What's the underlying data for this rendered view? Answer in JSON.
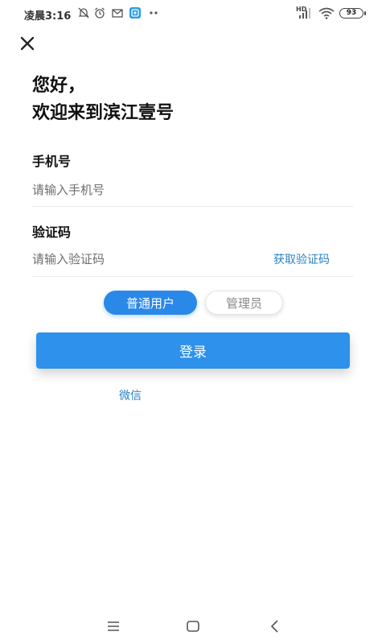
{
  "status_bar": {
    "time": "凌晨3:16",
    "network_label": "HD",
    "battery": "93",
    "icons": [
      "bell-muted-icon",
      "alarm-icon",
      "mail-icon",
      "app-notification-icon",
      "more-dots-icon",
      "signal-icon",
      "wifi-icon",
      "battery-icon"
    ]
  },
  "header": {
    "close_icon": "close-icon"
  },
  "greeting": {
    "line1": "您好，",
    "line2": "欢迎来到滨江壹号"
  },
  "phone": {
    "label": "手机号",
    "placeholder": "请输入手机号",
    "value": ""
  },
  "code": {
    "label": "验证码",
    "placeholder": "请输入验证码",
    "value": "",
    "get_code_label": "获取验证码"
  },
  "roles": {
    "user_label": "普通用户",
    "admin_label": "管理员",
    "selected": "普通用户"
  },
  "login_label": "登录",
  "wechat_label": "微信",
  "colors": {
    "accent": "#2e91ec",
    "link": "#2a83c6"
  },
  "nav_bar": {
    "icons": [
      "menu-icon",
      "home-icon",
      "back-icon"
    ]
  }
}
